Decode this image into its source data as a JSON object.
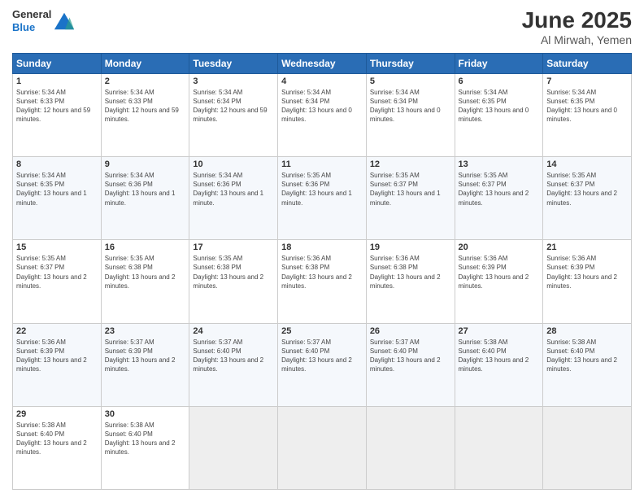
{
  "header": {
    "logo_general": "General",
    "logo_blue": "Blue",
    "title": "June 2025",
    "subtitle": "Al Mirwah, Yemen"
  },
  "weekdays": [
    "Sunday",
    "Monday",
    "Tuesday",
    "Wednesday",
    "Thursday",
    "Friday",
    "Saturday"
  ],
  "weeks": [
    [
      {
        "day": "1",
        "sunrise": "Sunrise: 5:34 AM",
        "sunset": "Sunset: 6:33 PM",
        "daylight": "Daylight: 12 hours and 59 minutes."
      },
      {
        "day": "2",
        "sunrise": "Sunrise: 5:34 AM",
        "sunset": "Sunset: 6:33 PM",
        "daylight": "Daylight: 12 hours and 59 minutes."
      },
      {
        "day": "3",
        "sunrise": "Sunrise: 5:34 AM",
        "sunset": "Sunset: 6:34 PM",
        "daylight": "Daylight: 12 hours and 59 minutes."
      },
      {
        "day": "4",
        "sunrise": "Sunrise: 5:34 AM",
        "sunset": "Sunset: 6:34 PM",
        "daylight": "Daylight: 13 hours and 0 minutes."
      },
      {
        "day": "5",
        "sunrise": "Sunrise: 5:34 AM",
        "sunset": "Sunset: 6:34 PM",
        "daylight": "Daylight: 13 hours and 0 minutes."
      },
      {
        "day": "6",
        "sunrise": "Sunrise: 5:34 AM",
        "sunset": "Sunset: 6:35 PM",
        "daylight": "Daylight: 13 hours and 0 minutes."
      },
      {
        "day": "7",
        "sunrise": "Sunrise: 5:34 AM",
        "sunset": "Sunset: 6:35 PM",
        "daylight": "Daylight: 13 hours and 0 minutes."
      }
    ],
    [
      {
        "day": "8",
        "sunrise": "Sunrise: 5:34 AM",
        "sunset": "Sunset: 6:35 PM",
        "daylight": "Daylight: 13 hours and 1 minute."
      },
      {
        "day": "9",
        "sunrise": "Sunrise: 5:34 AM",
        "sunset": "Sunset: 6:36 PM",
        "daylight": "Daylight: 13 hours and 1 minute."
      },
      {
        "day": "10",
        "sunrise": "Sunrise: 5:34 AM",
        "sunset": "Sunset: 6:36 PM",
        "daylight": "Daylight: 13 hours and 1 minute."
      },
      {
        "day": "11",
        "sunrise": "Sunrise: 5:35 AM",
        "sunset": "Sunset: 6:36 PM",
        "daylight": "Daylight: 13 hours and 1 minute."
      },
      {
        "day": "12",
        "sunrise": "Sunrise: 5:35 AM",
        "sunset": "Sunset: 6:37 PM",
        "daylight": "Daylight: 13 hours and 1 minute."
      },
      {
        "day": "13",
        "sunrise": "Sunrise: 5:35 AM",
        "sunset": "Sunset: 6:37 PM",
        "daylight": "Daylight: 13 hours and 2 minutes."
      },
      {
        "day": "14",
        "sunrise": "Sunrise: 5:35 AM",
        "sunset": "Sunset: 6:37 PM",
        "daylight": "Daylight: 13 hours and 2 minutes."
      }
    ],
    [
      {
        "day": "15",
        "sunrise": "Sunrise: 5:35 AM",
        "sunset": "Sunset: 6:37 PM",
        "daylight": "Daylight: 13 hours and 2 minutes."
      },
      {
        "day": "16",
        "sunrise": "Sunrise: 5:35 AM",
        "sunset": "Sunset: 6:38 PM",
        "daylight": "Daylight: 13 hours and 2 minutes."
      },
      {
        "day": "17",
        "sunrise": "Sunrise: 5:35 AM",
        "sunset": "Sunset: 6:38 PM",
        "daylight": "Daylight: 13 hours and 2 minutes."
      },
      {
        "day": "18",
        "sunrise": "Sunrise: 5:36 AM",
        "sunset": "Sunset: 6:38 PM",
        "daylight": "Daylight: 13 hours and 2 minutes."
      },
      {
        "day": "19",
        "sunrise": "Sunrise: 5:36 AM",
        "sunset": "Sunset: 6:38 PM",
        "daylight": "Daylight: 13 hours and 2 minutes."
      },
      {
        "day": "20",
        "sunrise": "Sunrise: 5:36 AM",
        "sunset": "Sunset: 6:39 PM",
        "daylight": "Daylight: 13 hours and 2 minutes."
      },
      {
        "day": "21",
        "sunrise": "Sunrise: 5:36 AM",
        "sunset": "Sunset: 6:39 PM",
        "daylight": "Daylight: 13 hours and 2 minutes."
      }
    ],
    [
      {
        "day": "22",
        "sunrise": "Sunrise: 5:36 AM",
        "sunset": "Sunset: 6:39 PM",
        "daylight": "Daylight: 13 hours and 2 minutes."
      },
      {
        "day": "23",
        "sunrise": "Sunrise: 5:37 AM",
        "sunset": "Sunset: 6:39 PM",
        "daylight": "Daylight: 13 hours and 2 minutes."
      },
      {
        "day": "24",
        "sunrise": "Sunrise: 5:37 AM",
        "sunset": "Sunset: 6:40 PM",
        "daylight": "Daylight: 13 hours and 2 minutes."
      },
      {
        "day": "25",
        "sunrise": "Sunrise: 5:37 AM",
        "sunset": "Sunset: 6:40 PM",
        "daylight": "Daylight: 13 hours and 2 minutes."
      },
      {
        "day": "26",
        "sunrise": "Sunrise: 5:37 AM",
        "sunset": "Sunset: 6:40 PM",
        "daylight": "Daylight: 13 hours and 2 minutes."
      },
      {
        "day": "27",
        "sunrise": "Sunrise: 5:38 AM",
        "sunset": "Sunset: 6:40 PM",
        "daylight": "Daylight: 13 hours and 2 minutes."
      },
      {
        "day": "28",
        "sunrise": "Sunrise: 5:38 AM",
        "sunset": "Sunset: 6:40 PM",
        "daylight": "Daylight: 13 hours and 2 minutes."
      }
    ],
    [
      {
        "day": "29",
        "sunrise": "Sunrise: 5:38 AM",
        "sunset": "Sunset: 6:40 PM",
        "daylight": "Daylight: 13 hours and 2 minutes."
      },
      {
        "day": "30",
        "sunrise": "Sunrise: 5:38 AM",
        "sunset": "Sunset: 6:40 PM",
        "daylight": "Daylight: 13 hours and 2 minutes."
      },
      null,
      null,
      null,
      null,
      null
    ]
  ]
}
